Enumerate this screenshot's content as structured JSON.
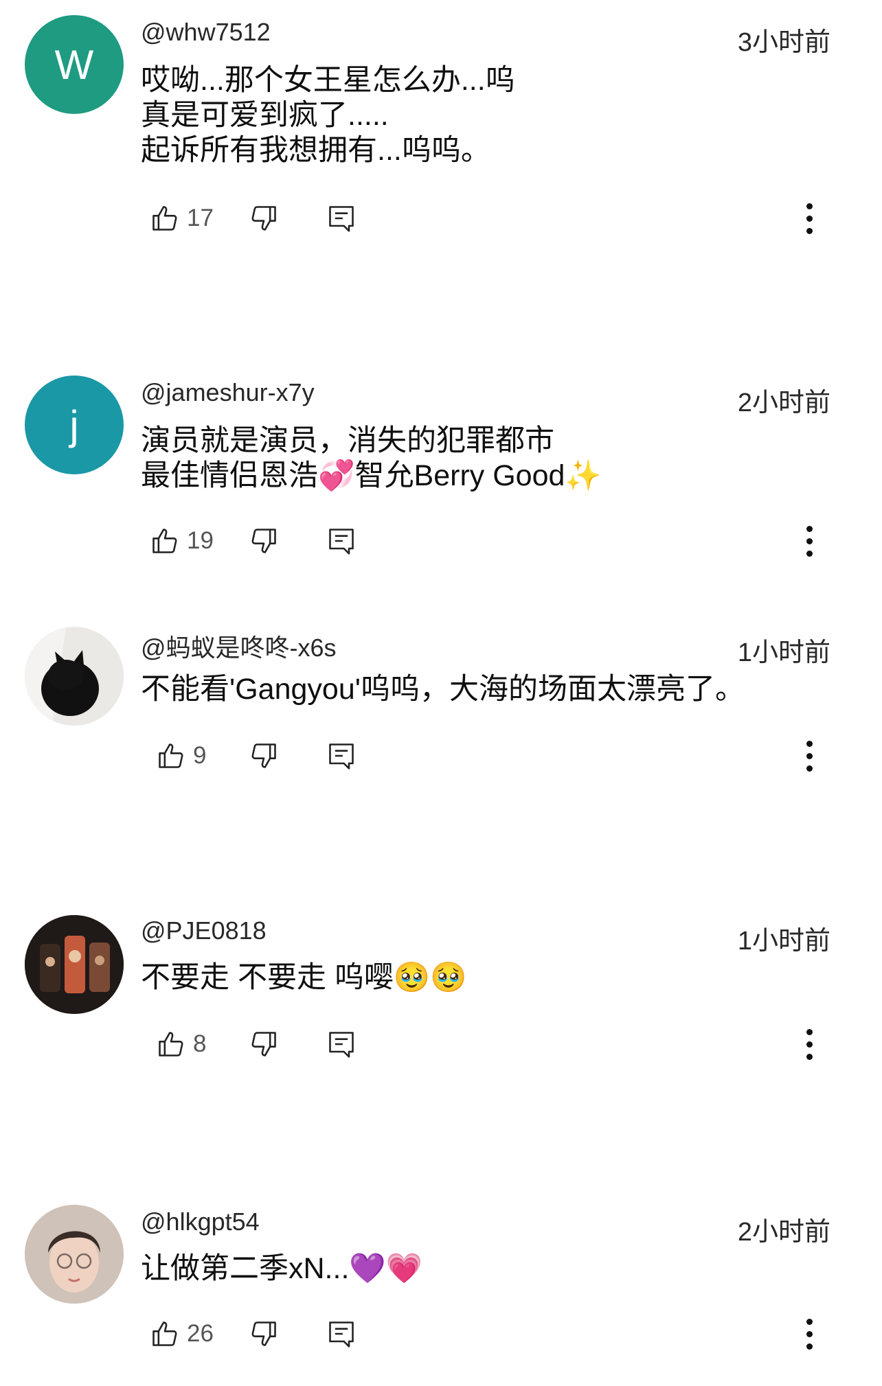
{
  "comments": [
    {
      "handle": "@whw7512",
      "time": "3小时前",
      "avatar_letter": "W",
      "avatar_color": "#1e9b80",
      "lines": [
        "哎呦...那个女王星怎么办...呜",
        "真是可爱到疯了.....",
        "起诉所有我想拥有...呜呜。"
      ],
      "likes": "17"
    },
    {
      "handle": "@jameshur-x7y",
      "time": "2小时前",
      "avatar_letter": "j",
      "avatar_color": "#1a98a6",
      "lines": [
        "演员就是演员，消失的犯罪都市",
        "最佳情侣恩浩💞智允Berry Good✨"
      ],
      "likes": "19"
    },
    {
      "handle": "@蚂蚁是咚咚-x6s",
      "time": "1小时前",
      "avatar_letter": "",
      "avatar_color": "#e8e6e3",
      "lines": [
        "不能看'Gangyou'呜呜，大海的场面太漂亮了。"
      ],
      "likes": "9"
    },
    {
      "handle": "@PJE0818",
      "time": "1小时前",
      "avatar_letter": "",
      "avatar_color": "#2a2420",
      "lines": [
        "不要走 不要走 呜嘤🥹🥹"
      ],
      "likes": "8"
    },
    {
      "handle": "@hlkgpt54",
      "time": "2小时前",
      "avatar_letter": "",
      "avatar_color": "#d9c9bd",
      "lines": [
        "让做第二季xN...💜💗"
      ],
      "likes": "26"
    }
  ],
  "icons": {
    "like": "thumbs-up-icon",
    "dislike": "thumbs-down-icon",
    "reply": "reply-comment-icon",
    "more": "more-vertical-icon"
  }
}
